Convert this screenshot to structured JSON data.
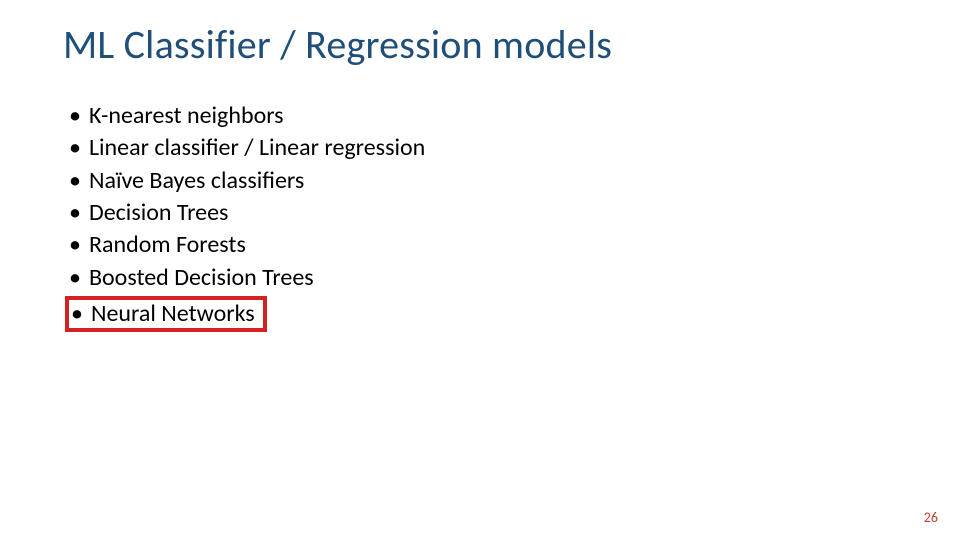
{
  "title": "ML Classifier / Regression models",
  "bullets": {
    "items": [
      "K-nearest neighbors",
      "Linear classifier / Linear regression",
      "Naïve Bayes classifiers",
      "Decision Trees",
      "Random Forests",
      "Boosted Decision Trees",
      "Neural Networks"
    ],
    "highlight_index": 6
  },
  "page_number": "26",
  "colors": {
    "title": "#1f4e79",
    "highlight_border": "#d32020",
    "page_number": "#bf3d31"
  }
}
